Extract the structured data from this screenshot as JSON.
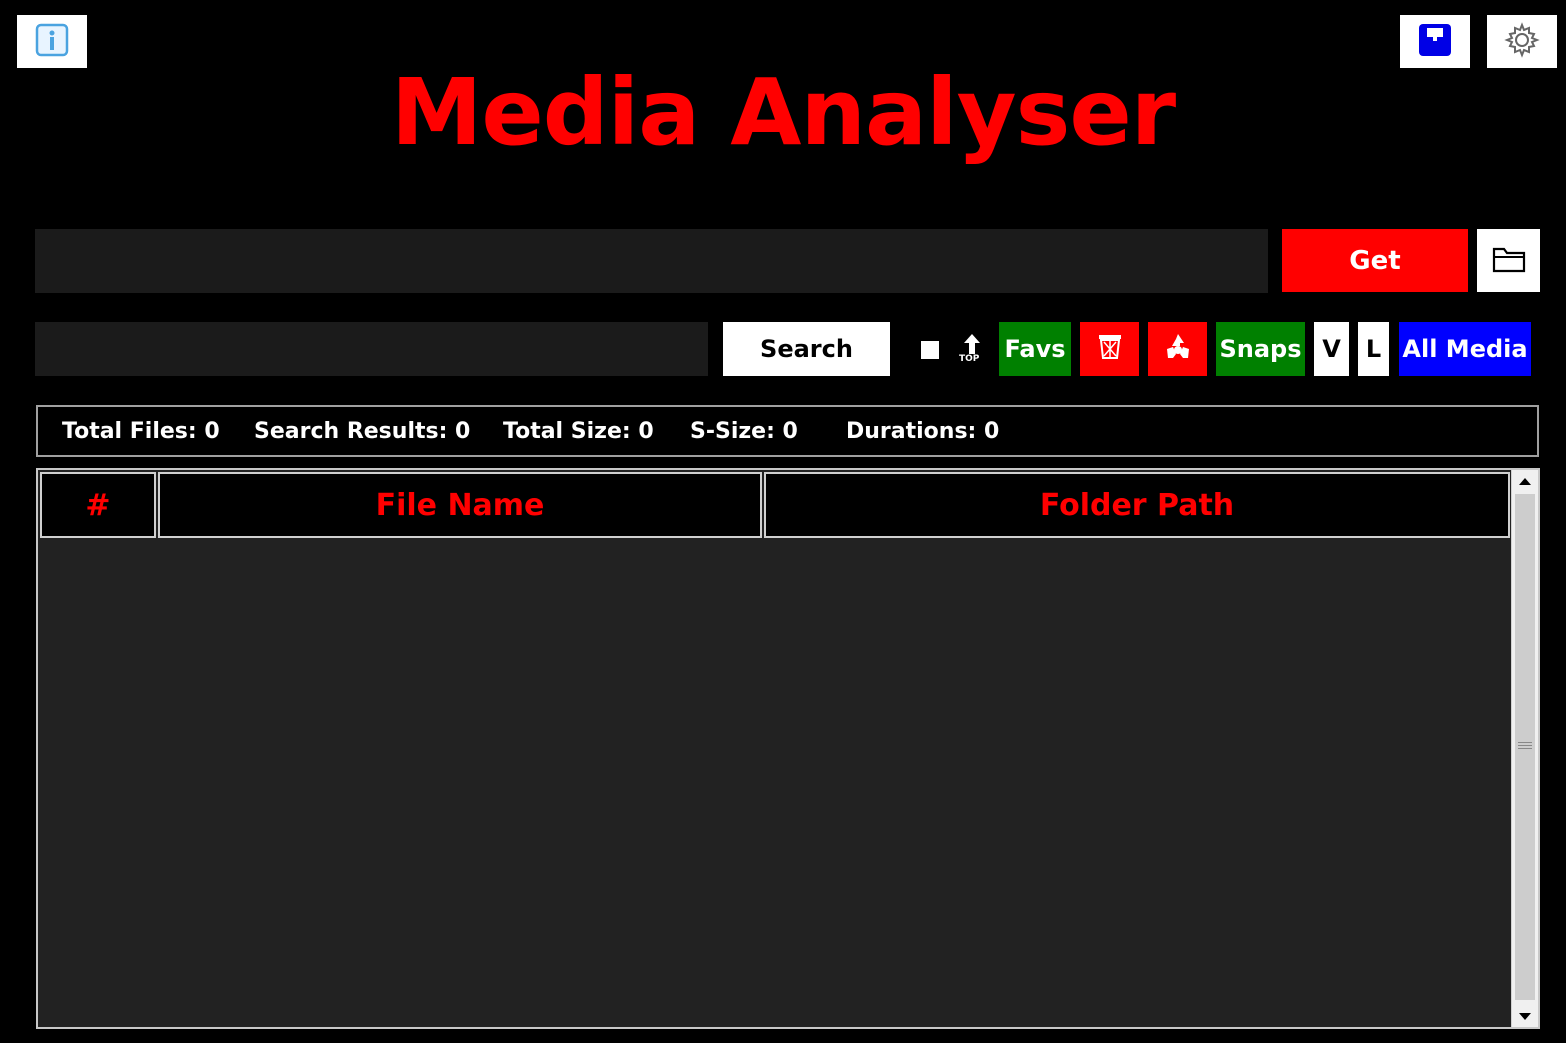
{
  "app": {
    "title": "Media Analyser"
  },
  "toolbar": {
    "info_icon": "info-icon",
    "save_icon": "save-icon",
    "settings_icon": "gear-icon"
  },
  "path_bar": {
    "value": "",
    "get_label": "Get",
    "browse_icon": "folder-icon"
  },
  "search_bar": {
    "value": "",
    "search_label": "Search",
    "checkbox_checked": false,
    "top_label": "TOP",
    "favs_label": "Favs",
    "delete_icon": "trash-icon",
    "recycle_icon": "recycle-icon",
    "snaps_label": "Snaps",
    "v_label": "V",
    "l_label": "L",
    "all_media_label": "All Media"
  },
  "stats": {
    "total_files": "Total Files: 0",
    "search_results": "Search Results: 0",
    "total_size": "Total Size: 0",
    "s_size": "S-Size: 0",
    "durations": "Durations: 0"
  },
  "table": {
    "columns": [
      "#",
      "File Name",
      "Folder Path"
    ],
    "rows": []
  },
  "colors": {
    "accent_red": "#ff0000",
    "favs_green": "#008000",
    "all_media_blue": "#0000ff"
  }
}
